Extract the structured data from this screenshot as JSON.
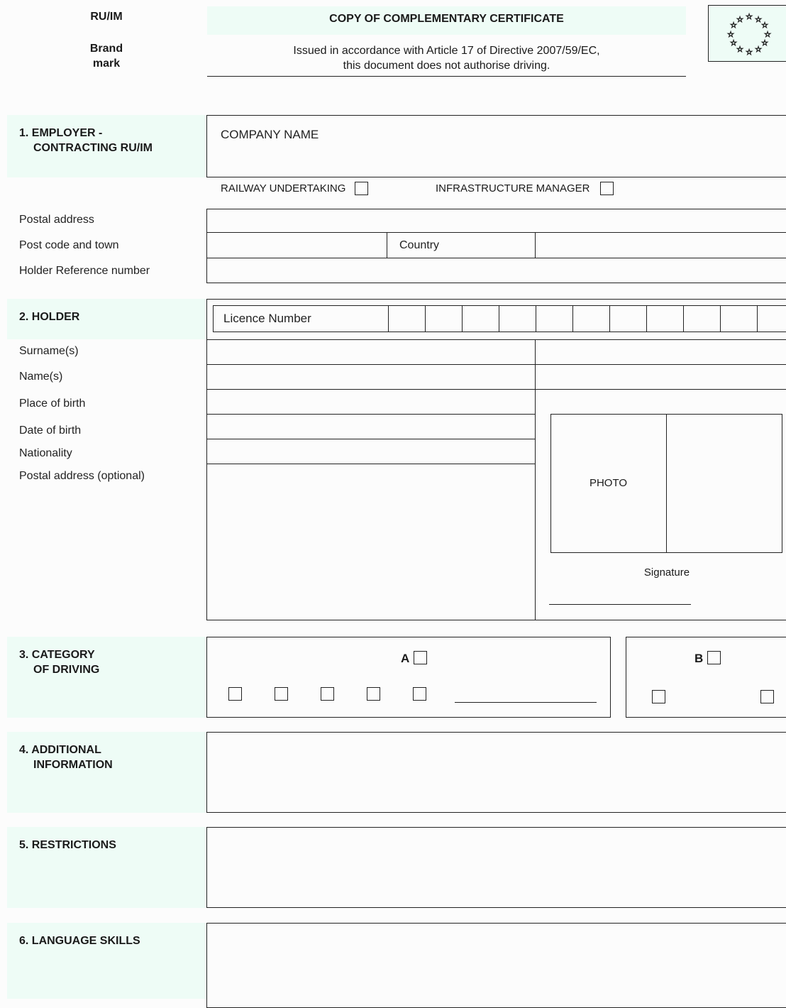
{
  "header": {
    "ruim": "RU/IM",
    "brand_line1": "Brand",
    "brand_line2": "mark",
    "title": "COPY OF COMPLEMENTARY CERTIFICATE",
    "subtitle_line1": "Issued in accordance with Article 17 of Directive 2007/59/EC,",
    "subtitle_line2": "this document does not authorise driving."
  },
  "section1": {
    "heading_line1": "1. EMPLOYER -",
    "heading_line2": "CONTRACTING RU/IM",
    "company_name": "COMPANY NAME",
    "railway_undertaking": "RAILWAY UNDERTAKING",
    "infrastructure_manager": "INFRASTRUCTURE MANAGER",
    "postal_address": "Postal address",
    "post_code_town": "Post code and town",
    "country": "Country",
    "holder_reference": "Holder Reference number"
  },
  "section2": {
    "heading": "2. HOLDER",
    "licence_number": "Licence Number",
    "surnames": "Surname(s)",
    "names": "Name(s)",
    "place_of_birth": "Place of birth",
    "date_of_birth": "Date of birth",
    "nationality": "Nationality",
    "postal_address_optional": "Postal address (optional)",
    "photo": "PHOTO",
    "signature": "Signature"
  },
  "section3": {
    "heading_line1": "3. CATEGORY",
    "heading_line2": "OF DRIVING",
    "cat_a": "A",
    "cat_b": "B"
  },
  "section4": {
    "heading_line1": "4. ADDITIONAL",
    "heading_line2": "INFORMATION"
  },
  "section5": {
    "heading": "5. RESTRICTIONS"
  },
  "section6": {
    "heading": "6. LANGUAGE SKILLS"
  },
  "emblem": {
    "icon": "eu-stars-icon",
    "background": "#eefcf6"
  },
  "colors": {
    "section_tint": "#eefcf6",
    "line": "#222222"
  }
}
